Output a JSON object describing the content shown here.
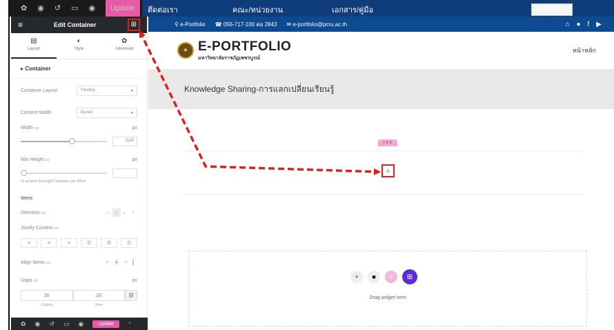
{
  "topbar": {
    "update_label": "Update",
    "nav": [
      "ติดต่อเรา",
      "คณะ/หน่วยงาน",
      "เอกสาร/คู่มือ"
    ],
    "counter": "000005"
  },
  "panel": {
    "title": "Edit Container",
    "tabs": [
      {
        "label": "Layout",
        "icon": "layout-icon"
      },
      {
        "label": "Style",
        "icon": "style-icon"
      },
      {
        "label": "Advanced",
        "icon": "advanced-icon"
      }
    ],
    "section": "Container",
    "container_layout": {
      "label": "Container Layout",
      "value": "Flexbox"
    },
    "content_width": {
      "label": "Content Width",
      "value": "Boxed"
    },
    "width": {
      "label": "Width",
      "unit": "px",
      "value": "1140"
    },
    "min_height": {
      "label": "Min Height",
      "unit": "px",
      "hint": "To achieve full height Container use 100vh"
    },
    "items_heading": "Items",
    "direction_label": "Direction",
    "justify_label": "Justify Content",
    "align_label": "Align Items",
    "gaps": {
      "label": "Gaps",
      "unit": "px",
      "column": "20",
      "row": "20",
      "column_label": "Column",
      "row_label": "Row"
    }
  },
  "bottombar": {
    "update_label": "Update"
  },
  "site": {
    "info": {
      "portfolio": "e-Portfolio",
      "phone": "056-717-100 ต่อ 2843",
      "email": "e-portfolio@pcru.ac.th"
    },
    "logo_title": "E-PORTFOLIO",
    "logo_subtitle": "มหาวิทยาลัยราชภัฏเพชรบูรณ์",
    "nav_home": "หน้าหลัก",
    "hero_title": "Knowledge Sharing-การแลกเปลี่ยนเรียนรู้",
    "drop_label": "Drag widget here"
  },
  "colors": {
    "accent_pink": "#e85aa7",
    "annotation_red": "#e01e1e",
    "site_blue": "#0d4a91",
    "purple": "#5c2bd7"
  }
}
